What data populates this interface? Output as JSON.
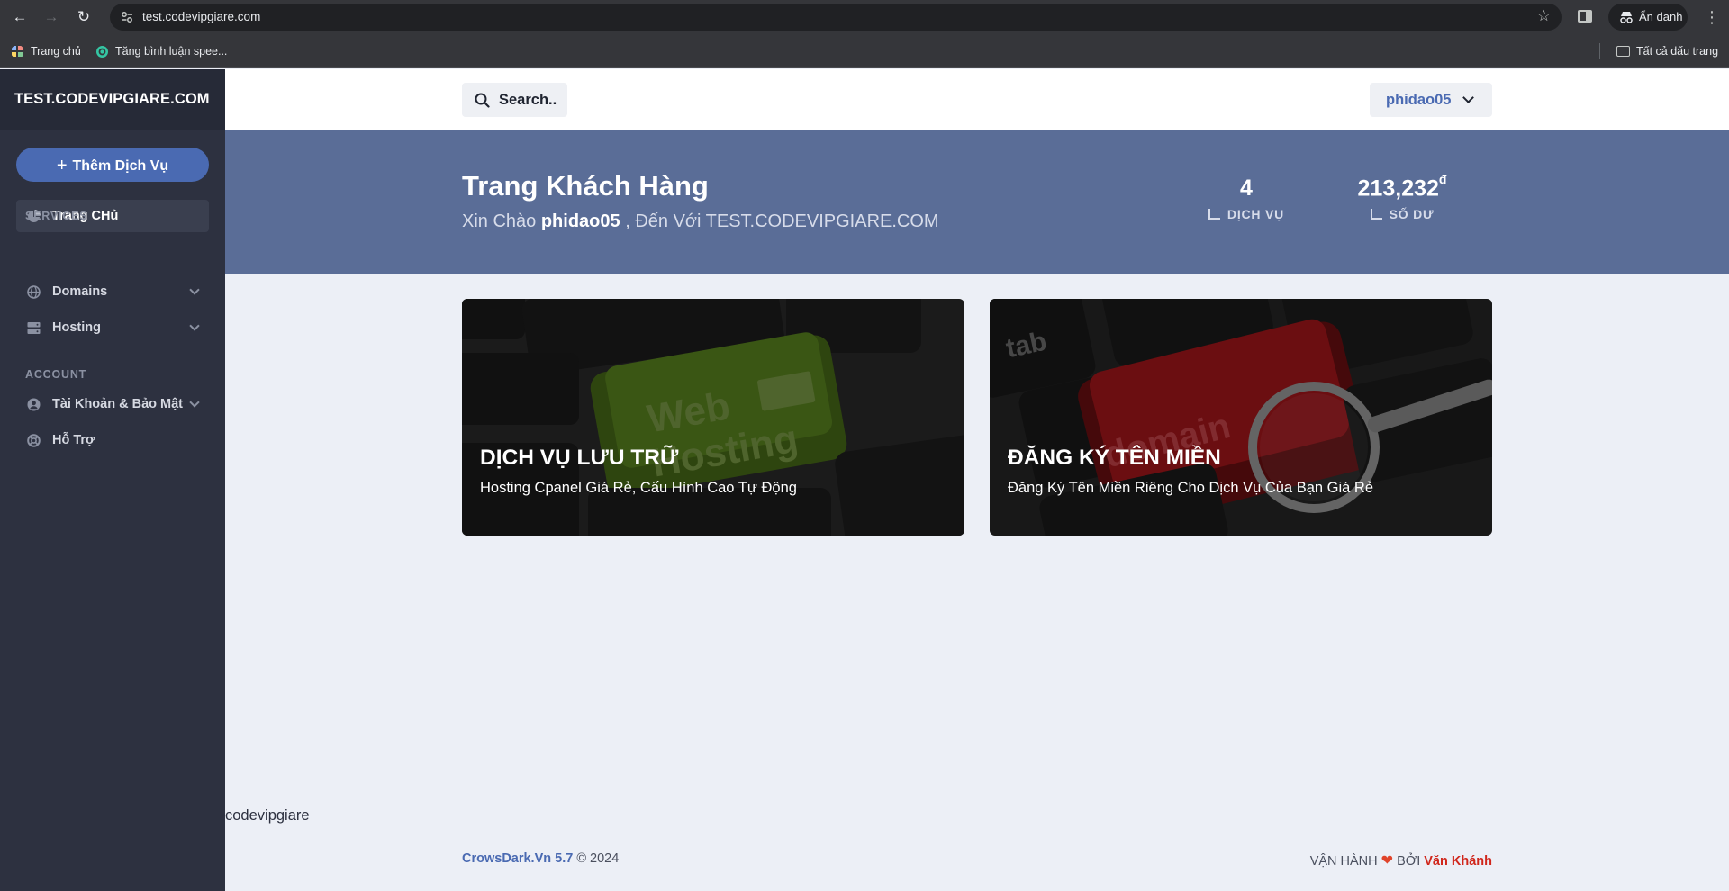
{
  "browser": {
    "url": "test.codevipgiare.com",
    "incognito_label": "Ẩn danh",
    "bookmarks": [
      {
        "label": "Trang chủ",
        "icon": "grid-icon"
      },
      {
        "label": "Tăng bình luận spee...",
        "icon": "swirl-icon"
      }
    ],
    "all_bookmarks_label": "Tất cả dấu trang"
  },
  "sidebar": {
    "brand": "TEST.CODEVIPGIARE.COM",
    "add_service_label": "Thêm Dịch Vụ",
    "home_label": "Trang CHủ",
    "sections": [
      {
        "heading": "SERVICES",
        "items": [
          {
            "label": "Domains",
            "icon": "globe-icon"
          },
          {
            "label": "Hosting",
            "icon": "server-icon"
          }
        ]
      },
      {
        "heading": "ACCOUNT",
        "items": [
          {
            "label": "Tài Khoản & Bảo Mật",
            "icon": "user-circle-icon"
          },
          {
            "label": "Hỗ Trợ",
            "icon": "lifebuoy-icon"
          }
        ]
      }
    ]
  },
  "topbar": {
    "search_label": "Search..",
    "username": "phidao05"
  },
  "hero": {
    "title": "Trang Khách Hàng",
    "greeting_prefix": "Xin Chào",
    "username": "phidao05",
    "greeting_suffix": ", Đến Với TEST.CODEVIPGIARE.COM",
    "stats": [
      {
        "value": "4",
        "unit": "",
        "label": "DỊCH VỤ"
      },
      {
        "value": "213,232",
        "unit": "đ",
        "label": "SỐ DƯ"
      }
    ]
  },
  "cards": [
    {
      "title": "DỊCH VỤ LƯU TRỮ",
      "subtitle": "Hosting Cpanel Giá Rẻ, Cấu Hình Cao Tự Động",
      "key_text_1": "Web",
      "key_text_2": "Hosting"
    },
    {
      "title": "ĐĂNG KÝ TÊN MIỀN",
      "subtitle": "Đăng Ký Tên Miền Riêng Cho Dịch Vụ Của Bạn Giá Rẻ",
      "key_text_1": "domain",
      "key_text_2": "tab"
    }
  ],
  "footer": {
    "brand": "codevipgiare",
    "copyright_link": "CrowsDark.Vn 5.7",
    "copyright_rest": "© 2024",
    "operated_by": "VẬN HÀNH",
    "by_word": "BỞI",
    "author": "Văn Khánh"
  },
  "colors": {
    "sidebar_bg": "#2d3140",
    "accent": "#4a6ab2",
    "hero_bg": "#5a6d97",
    "page_bg": "#eceff6"
  }
}
